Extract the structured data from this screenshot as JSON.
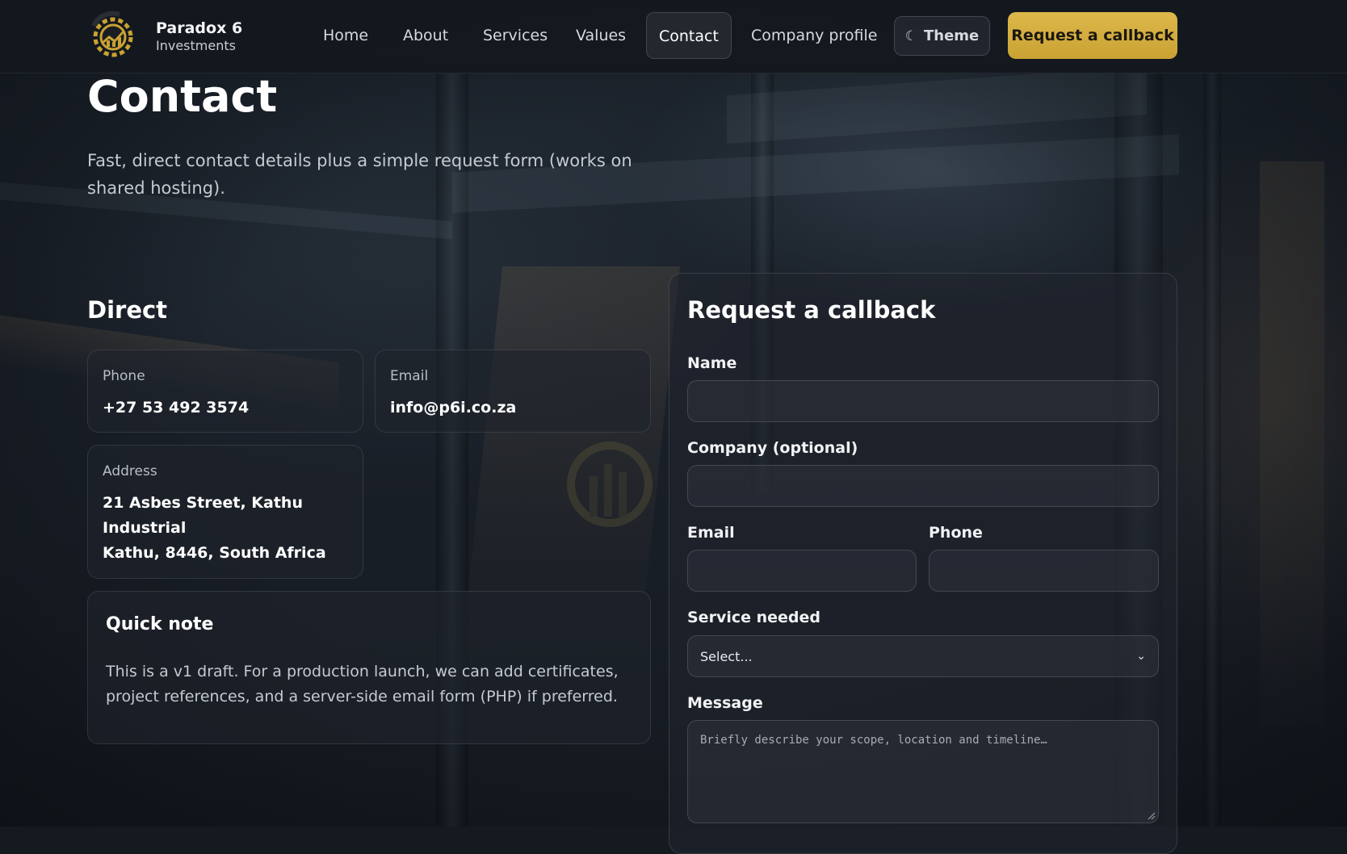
{
  "brand": {
    "name": "Paradox 6",
    "sub": "Investments",
    "accent": "#d6b13f"
  },
  "nav": {
    "items": [
      {
        "label": "Home"
      },
      {
        "label": "About"
      },
      {
        "label": "Services"
      },
      {
        "label": "Values"
      },
      {
        "label": "Contact"
      },
      {
        "label": "Company profile"
      }
    ],
    "active": "Contact",
    "theme_label": "Theme",
    "theme_icon": "moon-icon",
    "cta_label": "Request a callback"
  },
  "hero": {
    "title": "Contact",
    "subtitle": "Fast, direct contact details plus a simple request form (works on shared hosting)."
  },
  "direct": {
    "heading": "Direct",
    "phone": {
      "label": "Phone",
      "value": "+27 53 492 3574"
    },
    "email": {
      "label": "Email",
      "value": "info@p6i.co.za"
    },
    "address": {
      "label": "Address",
      "line1": "21 Asbes Street, Kathu",
      "line2": "Industrial",
      "line3": "Kathu, 8446, South Africa"
    },
    "note": {
      "title": "Quick note",
      "text": "This is a v1 draft. For a production launch, we can add certificates, project references, and a server-side email form (PHP) if preferred."
    }
  },
  "form": {
    "heading": "Request a callback",
    "name_label": "Name",
    "name_value": "",
    "company_label": "Company (optional)",
    "company_value": "",
    "email_label": "Email",
    "email_value": "",
    "phone_label": "Phone",
    "phone_value": "",
    "service_label": "Service needed",
    "service_selected": "Select...",
    "message_label": "Message",
    "message_placeholder": "Briefly describe your scope, location and timeline…"
  }
}
